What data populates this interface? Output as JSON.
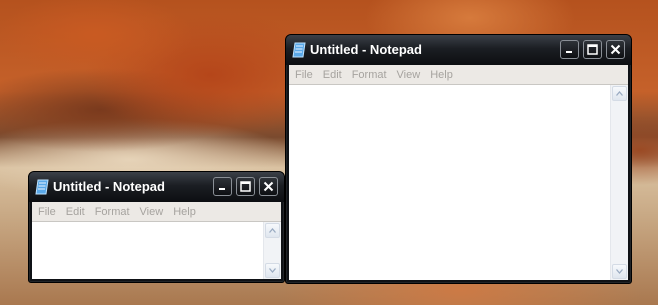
{
  "windows": [
    {
      "title": "Untitled - Notepad",
      "menu": [
        "File",
        "Edit",
        "Format",
        "View",
        "Help"
      ],
      "text": "",
      "controls": [
        "minimize-icon",
        "maximize-icon",
        "close-icon"
      ]
    },
    {
      "title": "Untitled - Notepad",
      "menu": [
        "File",
        "Edit",
        "Format",
        "View",
        "Help"
      ],
      "text": "",
      "controls": [
        "minimize-icon",
        "maximize-icon",
        "close-icon"
      ]
    }
  ],
  "colors": {
    "titlebar": "#1b1e23",
    "menubar": "#ece9e5",
    "menu_text_disabled": "#a6a39f",
    "desktop_rock": "#c5612a"
  }
}
